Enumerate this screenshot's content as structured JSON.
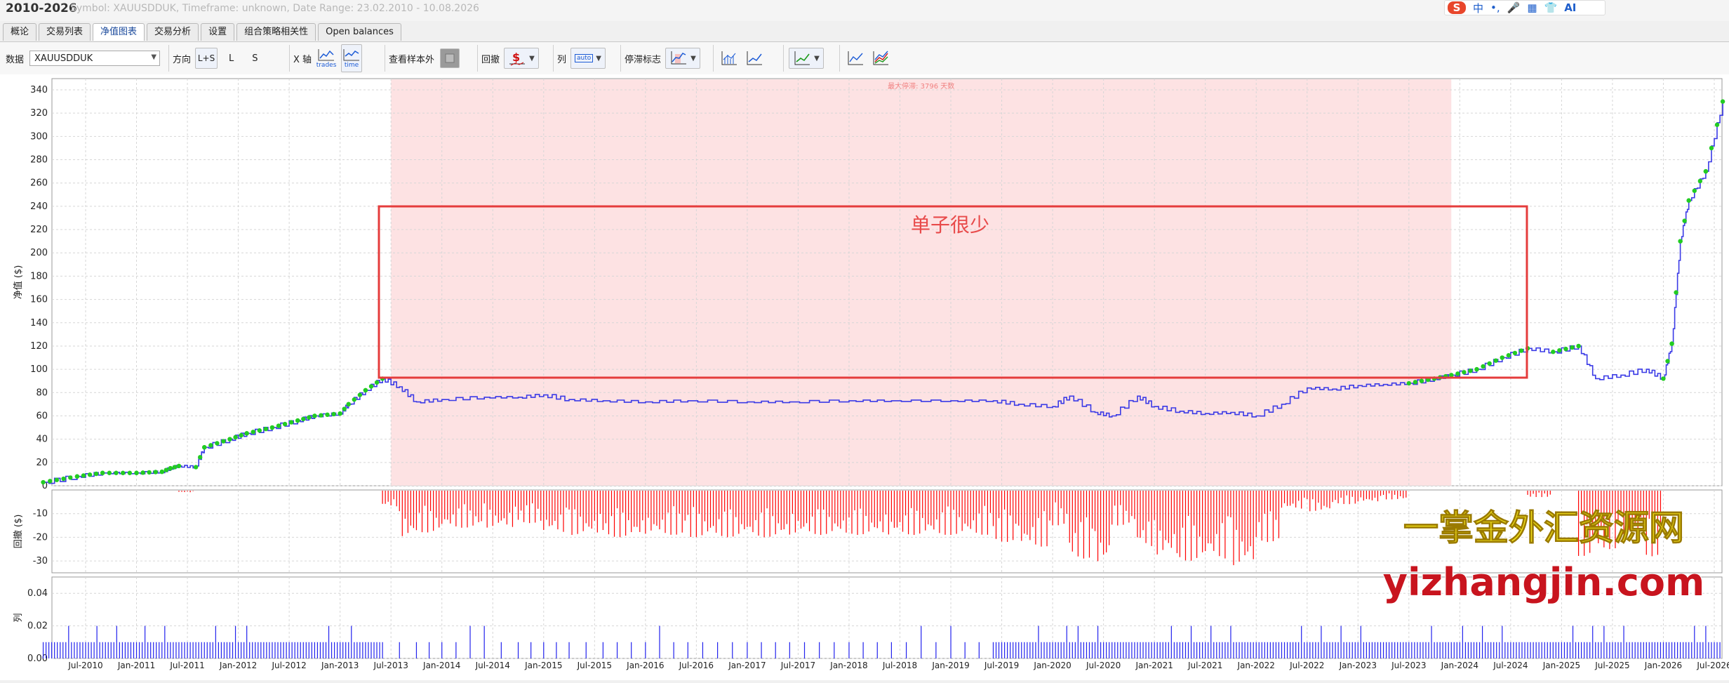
{
  "app": {
    "title": "2010-2026",
    "subtitle": "Symbol: XAUUSDDUK, Timeframe: unknown, Date Range: 23.02.2010 - 10.08.2026"
  },
  "ime": {
    "logo": "S",
    "lang": "中",
    "punct": "•,",
    "ai": "AI"
  },
  "tabs": [
    {
      "label": "概论"
    },
    {
      "label": "交易列表"
    },
    {
      "label": "净值图表"
    },
    {
      "label": "交易分析"
    },
    {
      "label": "设置"
    },
    {
      "label": "组合策略相关性"
    },
    {
      "label": "Open balances"
    }
  ],
  "active_tab": 2,
  "toolbar": {
    "data_label": "数据",
    "data_value": "XAUUSDDUK",
    "direction_label": "方向",
    "dir_ls": "L+S",
    "dir_l": "L",
    "dir_s": "S",
    "xaxis_label": "X 轴",
    "x_trades": "trades",
    "x_time": "time",
    "oos_label": "查看样本外",
    "chart_label": "回撤",
    "column_label": "列",
    "column_value": "auto",
    "stagnation_label": "停滞标志"
  },
  "annotation": {
    "text": "单子很少"
  },
  "stagnation_note": "最大停滞: 3796 天数",
  "watermark": {
    "cn": "一掌金外汇资源网",
    "url": "yizhangjin.com"
  },
  "axis_titles": {
    "equity": "净值 ($)",
    "drawdown": "回撤 ($)",
    "third": "列"
  },
  "colors": {
    "equity_line": "#3a3ae6",
    "new_high": "#22cc22",
    "drawdown": "#ff0000",
    "trades": "#2222ee",
    "stagnation_fill": "#fde2e3",
    "annotation": "#e84a4a",
    "watermark_cn": "#f2e21c",
    "watermark_url": "#c8141e"
  },
  "chart_data": {
    "type": "line",
    "equity": {
      "ylim": [
        0,
        340
      ],
      "yticks": [
        0,
        20,
        40,
        60,
        80,
        100,
        120,
        140,
        160,
        180,
        200,
        220,
        240,
        260,
        280,
        300,
        320,
        340
      ],
      "x": [
        "2010-02",
        "2010-06",
        "2010-09",
        "2011-01",
        "2011-04",
        "2011-05",
        "2011-06",
        "2011-08",
        "2011-09",
        "2011-12",
        "2012-02",
        "2012-05",
        "2012-08",
        "2012-10",
        "2013-01",
        "2013-02",
        "2013-04",
        "2013-06",
        "2013-08",
        "2013-10",
        "2014-01",
        "2014-06",
        "2014-10",
        "2015-01",
        "2015-04",
        "2015-08",
        "2016-01",
        "2016-06",
        "2017-01",
        "2017-06",
        "2018-01",
        "2018-06",
        "2019-01",
        "2019-06",
        "2019-09",
        "2020-01",
        "2020-03",
        "2020-06",
        "2020-08",
        "2020-11",
        "2021-01",
        "2021-04",
        "2021-07",
        "2021-10",
        "2022-01",
        "2022-04",
        "2022-07",
        "2022-10",
        "2023-01",
        "2023-04",
        "2023-07",
        "2023-10",
        "2023-12",
        "2024-03",
        "2024-06",
        "2024-09",
        "2024-12",
        "2025-03",
        "2025-05",
        "2025-08",
        "2025-11",
        "2026-01",
        "2026-02",
        "2026-03",
        "2026-04",
        "2026-06",
        "2026-08"
      ],
      "y": [
        3,
        8,
        11,
        11,
        12,
        15,
        17,
        16,
        33,
        40,
        45,
        50,
        56,
        60,
        62,
        70,
        82,
        92,
        85,
        72,
        74,
        76,
        76,
        78,
        74,
        73,
        72,
        73,
        72,
        72,
        73,
        73,
        73,
        73,
        70,
        68,
        77,
        63,
        60,
        77,
        68,
        64,
        62,
        63,
        60,
        70,
        84,
        83,
        86,
        87,
        88,
        92,
        95,
        100,
        110,
        118,
        115,
        120,
        92,
        95,
        100,
        92,
        122,
        210,
        245,
        270,
        330
      ]
    },
    "drawdown": {
      "ylim": [
        -35,
        0
      ],
      "yticks": [
        -30,
        -20,
        -10
      ]
    },
    "trades": {
      "ylim": [
        0,
        0.05
      ],
      "yticks": [
        0.0,
        0.02,
        0.04
      ]
    },
    "x_ticks": [
      "Jul-2010",
      "Jan-2011",
      "Jul-2011",
      "Jan-2012",
      "Jul-2012",
      "Jan-2013",
      "Jul-2013",
      "Jan-2014",
      "Jul-2014",
      "Jan-2015",
      "Jul-2015",
      "Jan-2016",
      "Jul-2016",
      "Jan-2017",
      "Jul-2017",
      "Jan-2018",
      "Jul-2018",
      "Jan-2019",
      "Jul-2019",
      "Jan-2020",
      "Jul-2020",
      "Jan-2021",
      "Jul-2021",
      "Jan-2022",
      "Jul-2022",
      "Jan-2023",
      "Jul-2023",
      "Jan-2024",
      "Jul-2024",
      "Jan-2025",
      "Jul-2025",
      "Jan-2026",
      "Jul-2026"
    ],
    "stagnation_period": [
      "2013-07",
      "2023-12"
    ],
    "grid": true
  }
}
